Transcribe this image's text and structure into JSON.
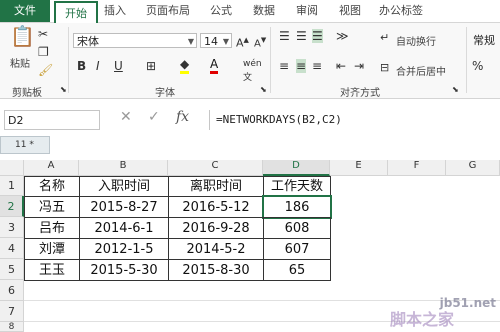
{
  "tabs": {
    "file": "文件",
    "home": "开始",
    "insert": "插入",
    "layout": "页面布局",
    "formulas": "公式",
    "data": "数据",
    "review": "审阅",
    "view": "视图",
    "office": "办公标签"
  },
  "ribbon": {
    "paste_label": "粘贴",
    "clipboard_label": "剪贴板",
    "font_name": "宋体",
    "font_size": "14",
    "font_group_label": "字体",
    "wrap_text": "自动换行",
    "merge_center": "合并后居中",
    "align_group_label": "对齐方式",
    "number_format": "常规",
    "bold": "B",
    "italic": "I",
    "underline": "U"
  },
  "formula_bar": {
    "name_box": "D2",
    "fx": "fx",
    "formula": "=NETWORKDAYS(B2,C2)"
  },
  "sheet_tab": "11 *",
  "columns": [
    "A",
    "B",
    "C",
    "D",
    "E",
    "F",
    "G"
  ],
  "rows": [
    "1",
    "2",
    "3",
    "4",
    "5",
    "6",
    "7",
    "8"
  ],
  "table": {
    "header": [
      "名称",
      "入职时间",
      "离职时间",
      "工作天数"
    ],
    "rows": [
      [
        "冯五",
        "2015-8-27",
        "2016-5-12",
        "186"
      ],
      [
        "吕布",
        "2014-6-1",
        "2016-9-28",
        "608"
      ],
      [
        "刘潭",
        "2012-1-5",
        "2014-5-2",
        "607"
      ],
      [
        "王玉",
        "2015-5-30",
        "2015-8-30",
        "65"
      ]
    ]
  },
  "watermark": "jb51.net",
  "watermark2": "脚本之家",
  "colors": {
    "accent": "#217346"
  }
}
